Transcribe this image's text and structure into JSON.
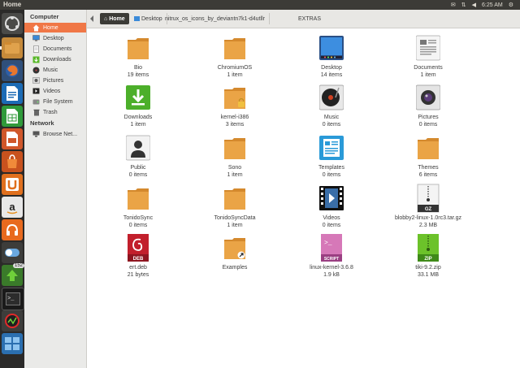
{
  "window": {
    "title": "Home"
  },
  "topbar": {
    "time": "6:25 AM"
  },
  "sidebar": {
    "computer_header": "Computer",
    "items": [
      {
        "label": "Home",
        "icon": "home-icon",
        "active": true
      },
      {
        "label": "Desktop",
        "icon": "desktop-icon"
      },
      {
        "label": "Documents",
        "icon": "documents-icon"
      },
      {
        "label": "Downloads",
        "icon": "downloads-icon"
      },
      {
        "label": "Music",
        "icon": "music-icon"
      },
      {
        "label": "Pictures",
        "icon": "pictures-icon"
      },
      {
        "label": "Videos",
        "icon": "videos-icon"
      },
      {
        "label": "File System",
        "icon": "harddisk-icon"
      },
      {
        "label": "Trash",
        "icon": "trash-icon"
      }
    ],
    "network_header": "Network",
    "network_items": [
      {
        "label": "Browse Net...",
        "icon": "network-icon"
      }
    ]
  },
  "breadcrumb": [
    {
      "label": "Home",
      "active": true
    },
    {
      "label": "Desktop"
    },
    {
      "label": "nitrux_os_icons_by_deviantn7k1-d4utllr"
    },
    {
      "label": "EXTRAS"
    }
  ],
  "files": [
    {
      "name": "Bio",
      "sub": "19 items",
      "icon": "folder-icon"
    },
    {
      "name": "ChromiumOS",
      "sub": "1 item",
      "icon": "folder-icon"
    },
    {
      "name": "Desktop",
      "sub": "14 items",
      "icon": "desktop-folder-icon"
    },
    {
      "name": "Documents",
      "sub": "1 item",
      "icon": "documents-folder-icon"
    },
    {
      "name": "Downloads",
      "sub": "1 item",
      "icon": "downloads-folder-icon"
    },
    {
      "name": "kernel-i386",
      "sub": "3 items",
      "icon": "locked-folder-icon"
    },
    {
      "name": "Music",
      "sub": "0 items",
      "icon": "music-folder-icon"
    },
    {
      "name": "Pictures",
      "sub": "0 items",
      "icon": "pictures-folder-icon"
    },
    {
      "name": "Public",
      "sub": "0 items",
      "icon": "public-folder-icon"
    },
    {
      "name": "Sono",
      "sub": "1 item",
      "icon": "folder-icon"
    },
    {
      "name": "Templates",
      "sub": "0 items",
      "icon": "templates-folder-icon"
    },
    {
      "name": "Themes",
      "sub": "6 items",
      "icon": "folder-icon"
    },
    {
      "name": "TonidoSync",
      "sub": "0 items",
      "icon": "folder-icon"
    },
    {
      "name": "TonidoSyncData",
      "sub": "1 item",
      "icon": "folder-icon"
    },
    {
      "name": "Videos",
      "sub": "0 items",
      "icon": "videos-folder-icon"
    },
    {
      "name": "blobby2-linux-1.0rc3.tar.gz",
      "sub": "2.3 MB",
      "icon": "archive-gz-icon",
      "badge": "GZ"
    },
    {
      "name": "ert.deb",
      "sub": "21 bytes",
      "icon": "deb-package-icon",
      "badge": "DEB"
    },
    {
      "name": "Examples",
      "sub": "",
      "icon": "symlink-folder-icon"
    },
    {
      "name": "linux-kernel-3.6.8",
      "sub": "1.9 kB",
      "icon": "script-file-icon",
      "badge": "SCRIPT"
    },
    {
      "name": "tiki-9.2.zip",
      "sub": "33.1 MB",
      "icon": "archive-zip-icon",
      "badge": "ZIP"
    }
  ],
  "launcher": [
    {
      "icon": "dash-icon"
    },
    {
      "icon": "files-icon"
    },
    {
      "icon": "firefox-icon"
    },
    {
      "icon": "writer-icon"
    },
    {
      "icon": "calc-icon"
    },
    {
      "icon": "impress-icon"
    },
    {
      "icon": "software-center-icon"
    },
    {
      "icon": "ubuntu-one-icon"
    },
    {
      "icon": "amazon-icon"
    },
    {
      "icon": "music-player-icon"
    },
    {
      "icon": "settings-toggle-icon"
    },
    {
      "icon": "update-manager-icon",
      "badge": "152"
    },
    {
      "icon": "terminal-icon"
    },
    {
      "icon": "system-monitor-icon"
    },
    {
      "icon": "workspace-icon"
    }
  ],
  "colors": {
    "accent": "#f07746",
    "folder": "#e09a3a",
    "panel": "#3c3b37",
    "launcher": "#2b2a29"
  }
}
